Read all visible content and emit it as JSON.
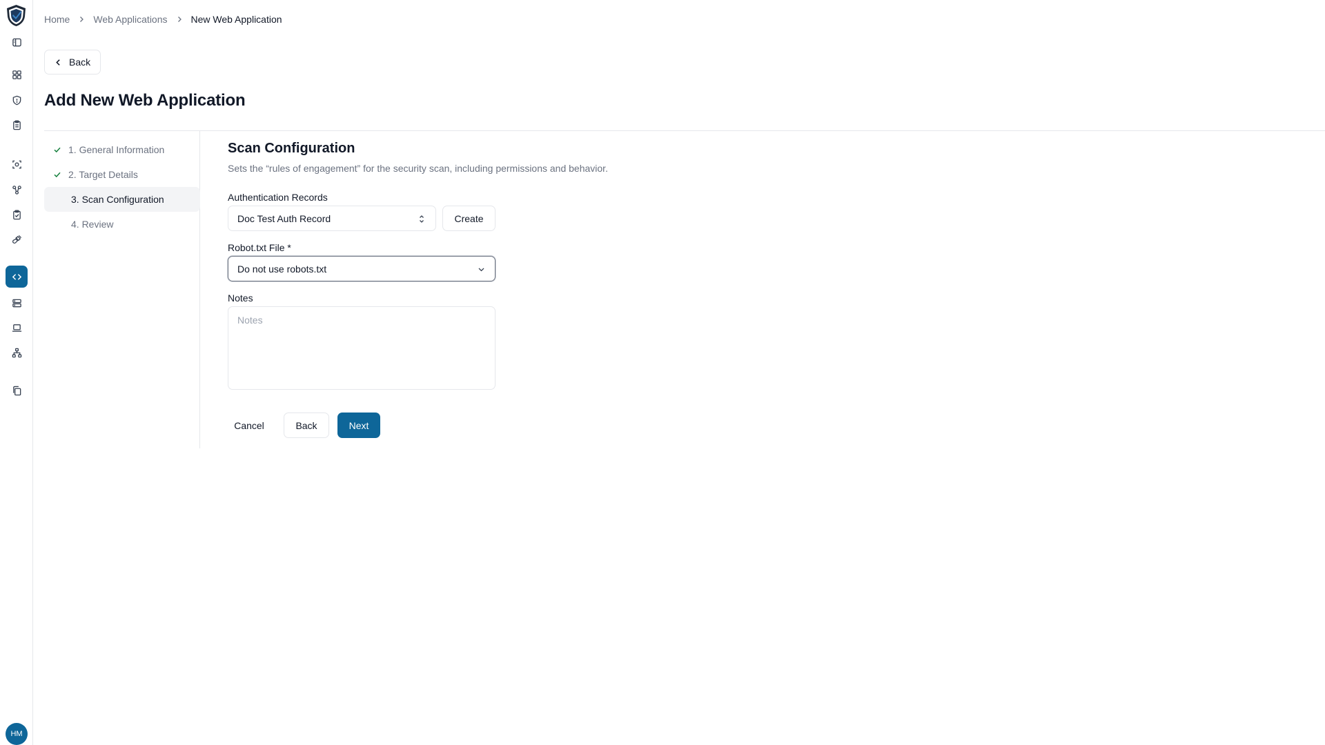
{
  "theme": {
    "accent": "#0e6699",
    "muted_text": "#6b7280",
    "border": "#e5e7eb"
  },
  "rail": {
    "icons": [
      "shield-logo-icon",
      "sidebar-toggle-icon",
      "dashboard-icon",
      "shield-icon",
      "clipboard-icon",
      "scan-focus-icon",
      "network-nodes-icon",
      "clipboard-check-icon",
      "plugs-icon",
      "code-icon",
      "server-icon",
      "laptop-icon",
      "sitemap-icon",
      "copy-documents-icon"
    ],
    "active": "code-icon",
    "user_initials": "HM"
  },
  "breadcrumb": {
    "items": [
      "Home",
      "Web Applications",
      "New Web Application"
    ]
  },
  "header": {
    "back_label": "Back",
    "title": "Add New Web Application"
  },
  "stepper": {
    "steps": [
      {
        "label": "1. General Information",
        "status": "complete"
      },
      {
        "label": "2. Target Details",
        "status": "complete"
      },
      {
        "label": "3. Scan Configuration",
        "status": "current"
      },
      {
        "label": "4. Review",
        "status": "pending"
      }
    ]
  },
  "form": {
    "section_title": "Scan Configuration",
    "section_description": "Sets the “rules of engagement” for the security scan, including permissions and behavior.",
    "auth_label": "Authentication Records",
    "auth_value": "Doc Test Auth Record",
    "create_label": "Create",
    "robots_label": "Robot.txt File *",
    "robots_value": "Do not use robots.txt",
    "notes_label": "Notes",
    "notes_placeholder": "Notes",
    "notes_value": ""
  },
  "actions": {
    "cancel_label": "Cancel",
    "back_label": "Back",
    "next_label": "Next"
  }
}
